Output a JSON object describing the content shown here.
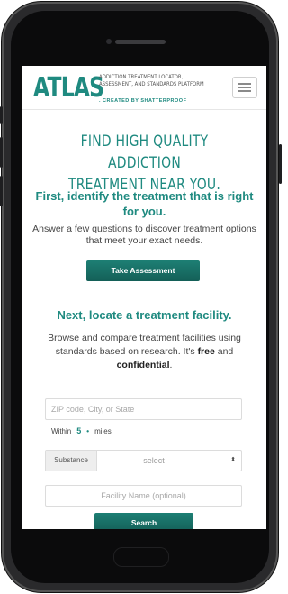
{
  "header": {
    "logo": "ATLAS",
    "tagline": "Addiction Treatment Locator, Assessment, and Standards Platform",
    "created_by": ". CREATED BY SHATTERPROOF"
  },
  "hero": {
    "title_line1": "FIND HIGH QUALITY ADDICTION",
    "title_line2": "TREATMENT NEAR YOU."
  },
  "identify": {
    "heading": "First, identify the treatment that is right for you.",
    "body": "Answer a few questions to discover treatment options that meet your exact needs.",
    "button": "Take Assessment"
  },
  "locate": {
    "heading": "Next, locate a treatment facility.",
    "body_prefix": "Browse and compare treatment facilities using standards based on research. It's ",
    "free": "free",
    "and": " and ",
    "confidential": "confidential",
    "period": "."
  },
  "search": {
    "zip_placeholder": "ZIP code, City, or State",
    "within_label": "Within",
    "within_value": "5",
    "within_dot": "•",
    "miles_label": "miles",
    "substance_label": "Substance",
    "substance_value": "select",
    "substance_caret": "⬍",
    "facility_placeholder": "Facility Name (optional)",
    "button": "Search"
  },
  "colors": {
    "accent": "#1f8a80",
    "button": "#176b62"
  }
}
